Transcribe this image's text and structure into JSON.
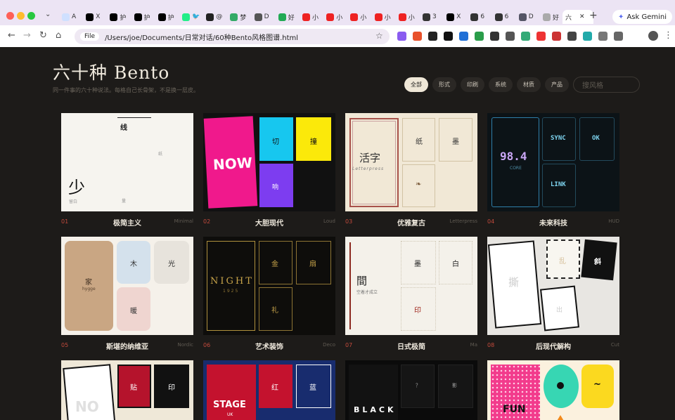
{
  "browser": {
    "tabs": [
      {
        "label": "A",
        "fav": "#cfe0ff"
      },
      {
        "label": "X",
        "fav": "#000"
      },
      {
        "label": "护",
        "fav": "#000"
      },
      {
        "label": "护",
        "fav": "#000"
      },
      {
        "label": "护",
        "fav": "#000"
      },
      {
        "label": "🐦",
        "fav": "#2e8"
      },
      {
        "label": "@",
        "fav": "#222"
      },
      {
        "label": "梦",
        "fav": "#3a6"
      },
      {
        "label": "D",
        "fav": "#555"
      },
      {
        "label": "好",
        "fav": "#2a5"
      },
      {
        "label": "小",
        "fav": "#e22"
      },
      {
        "label": "小",
        "fav": "#e22"
      },
      {
        "label": "小",
        "fav": "#e22"
      },
      {
        "label": "小",
        "fav": "#e22"
      },
      {
        "label": "小",
        "fav": "#e22"
      },
      {
        "label": "3",
        "fav": "#333"
      },
      {
        "label": "X",
        "fav": "#000"
      },
      {
        "label": "6",
        "fav": "#333"
      },
      {
        "label": "6",
        "fav": "#333"
      },
      {
        "label": "D",
        "fav": "#556"
      },
      {
        "label": "好",
        "fav": "#aaa"
      }
    ],
    "active_tab_label": "六",
    "ask_gemini": "Ask Gemini",
    "address_chip": "File",
    "address": "/Users/joe/Documents/日常对话/60种Bento风格图谱.html"
  },
  "page": {
    "title": "六十种 Bento",
    "subtitle": "同一件事的六十种说法。每格自己长骨架，不是换一层皮。",
    "filters": [
      "全部",
      "形式",
      "印刷",
      "系统",
      "材质",
      "产品"
    ],
    "search_placeholder": "搜风格"
  },
  "cards": [
    {
      "num": "01",
      "name": "极简主义",
      "en": "Minimal",
      "texts": {
        "a": "线",
        "b": "纸",
        "c": "少",
        "d": "留白",
        "e": "量"
      }
    },
    {
      "num": "02",
      "name": "大胆现代",
      "en": "Loud",
      "texts": {
        "a": "NOW",
        "b": "切",
        "c": "撞",
        "d": "响"
      }
    },
    {
      "num": "03",
      "name": "优雅复古",
      "en": "Letterpress",
      "texts": {
        "a": "活字",
        "b": "Letterpress",
        "c": "纸",
        "d": "墨",
        "e": "❧"
      }
    },
    {
      "num": "04",
      "name": "未来科技",
      "en": "HUD",
      "texts": {
        "a": "98.4",
        "b": "CORE",
        "c": "SYNC",
        "d": "OK",
        "e": "LINK"
      }
    },
    {
      "num": "05",
      "name": "斯堪的纳维亚",
      "en": "Nordic",
      "texts": {
        "a": "家",
        "b": "hygge",
        "c": "木",
        "d": "光",
        "e": "暖"
      }
    },
    {
      "num": "06",
      "name": "艺术装饰",
      "en": "Deco",
      "texts": {
        "a": "NIGHT",
        "b": "1925",
        "c": "金",
        "d": "扇",
        "e": "礼"
      }
    },
    {
      "num": "07",
      "name": "日式极简",
      "en": "Ma",
      "texts": {
        "a": "間",
        "b": "空着才成立",
        "c": "墨",
        "d": "白",
        "e": "印"
      }
    },
    {
      "num": "08",
      "name": "后现代解构",
      "en": "Cut",
      "texts": {
        "a": "撕",
        "b": "乱",
        "c": "斜",
        "d": "出"
      }
    },
    {
      "texts": {
        "a": "NO",
        "b": "贴",
        "c": "印"
      }
    },
    {
      "texts": {
        "a": "STAGE",
        "b": "UK",
        "c": "红",
        "d": "蓝"
      }
    },
    {
      "texts": {
        "a": "BLACK",
        "b": "？",
        "c": "影"
      }
    },
    {
      "texts": {
        "a": "FUN",
        "b": "~"
      }
    }
  ],
  "colors": {
    "bg": "#1d1b19",
    "accent": "#c34a3c",
    "chrome": "#ece4f4"
  }
}
